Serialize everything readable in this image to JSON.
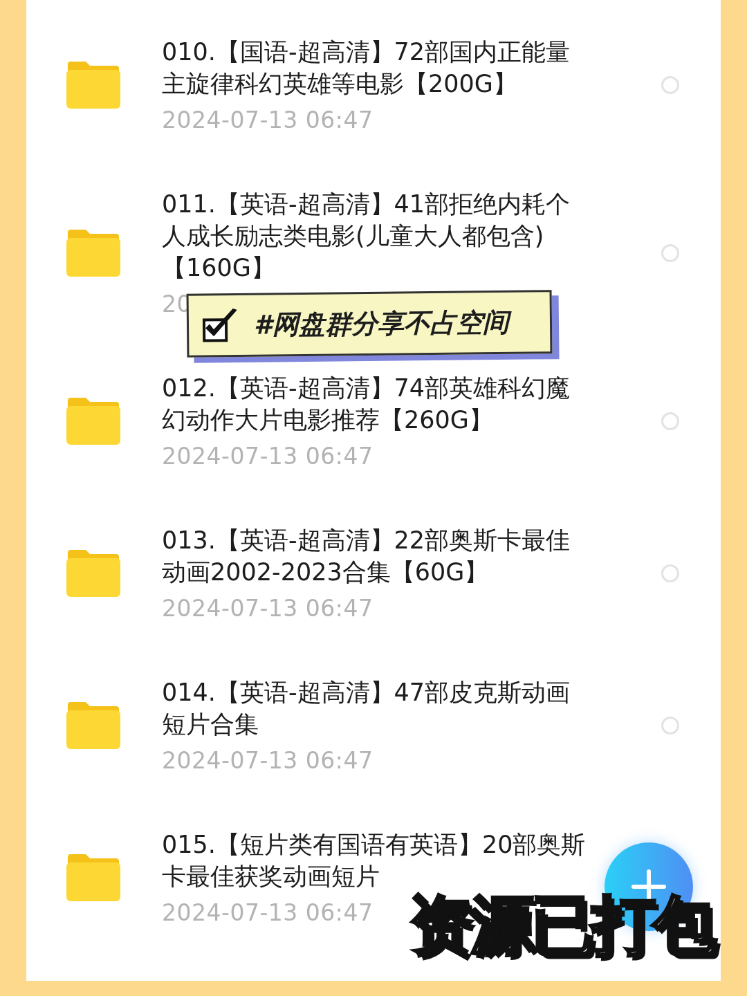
{
  "files": [
    {
      "title_lines": [
        "010.【国语-超高清】72部国内正能量",
        "主旋律科幻英雄等电影【200G】"
      ],
      "date": "2024-07-13  06:47",
      "selected": false
    },
    {
      "title_lines": [
        "011.【英语-超高清】41部拒绝内耗个",
        "人成长励志类电影(儿童大人都包含)",
        "【160G】"
      ],
      "date": "20",
      "selected": false
    },
    {
      "title_lines": [
        "012.【英语-超高清】74部英雄科幻魔",
        "幻动作大片电影推荐【260G】"
      ],
      "date": "2024-07-13  06:47",
      "selected": false
    },
    {
      "title_lines": [
        "013.【英语-超高清】22部奥斯卡最佳",
        "动画2002-2023合集【60G】"
      ],
      "date": "2024-07-13  06:47",
      "selected": false
    },
    {
      "title_lines": [
        "014.【英语-超高清】47部皮克斯动画",
        "短片合集"
      ],
      "date": "2024-07-13  06:47",
      "selected": false
    },
    {
      "title_lines": [
        "015.【短片类有国语有英语】20部奥斯",
        "卡最佳获奖动画短片"
      ],
      "date": "2024-07-13  06:47"
    }
  ],
  "sticker": {
    "text": "#网盘群分享不占空间",
    "checked": true
  },
  "banner": "资源已打包"
}
